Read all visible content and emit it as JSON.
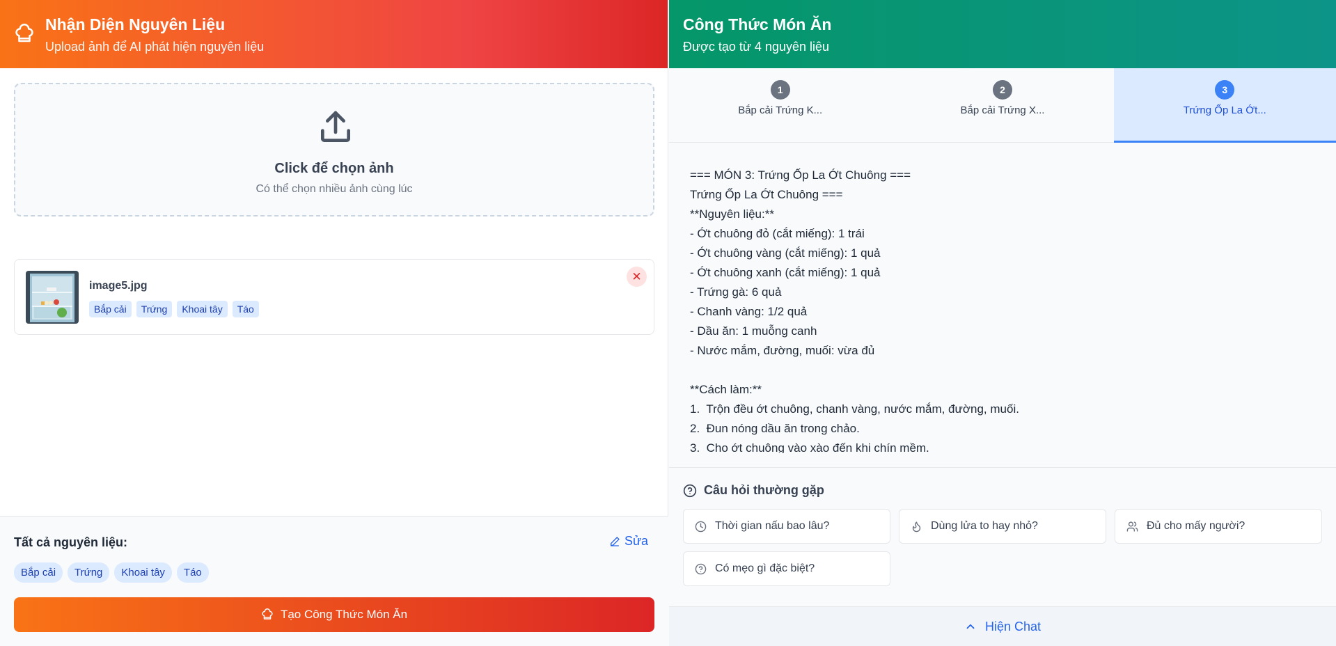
{
  "left_panel": {
    "header": {
      "title": "Nhận Diện Nguyên Liệu",
      "subtitle": "Upload ảnh để AI phát hiện nguyên liệu"
    },
    "upload": {
      "title": "Click để chọn ảnh",
      "hint": "Có thể chọn nhiều ảnh cùng lúc"
    },
    "files": [
      {
        "name": "image5.jpg",
        "tags": [
          "Bắp cải",
          "Trứng",
          "Khoai tây",
          "Táo"
        ],
        "remove_label": "✕"
      }
    ],
    "footer": {
      "all_label": "Tất cả nguyên liệu:",
      "edit_label": "Sửa",
      "ingredients": [
        "Bắp cải",
        "Trứng",
        "Khoai tây",
        "Táo"
      ],
      "generate_label": "Tạo Công Thức Món Ăn"
    }
  },
  "right_panel": {
    "header": {
      "title": "Công Thức Món Ăn",
      "subtitle": "Được tạo từ 4 nguyên liệu"
    },
    "tabs": [
      {
        "number": "1",
        "label": "Bắp cải Trứng K..."
      },
      {
        "number": "2",
        "label": "Bắp cải Trứng X..."
      },
      {
        "number": "3",
        "label": "Trứng Ốp La Ớt..."
      }
    ],
    "active_tab": 2,
    "recipe_lines": [
      "=== MÓN 3: Trứng Ốp La Ớt Chuông ===",
      "Trứng Ốp La Ớt Chuông ===",
      "**Nguyên liệu:**",
      "- Ớt chuông đỏ (cắt miếng): 1 trái",
      "- Ớt chuông vàng (cắt miếng): 1 quả",
      "- Ớt chuông xanh (cắt miếng): 1 quả",
      "- Trứng gà: 6 quả",
      "- Chanh vàng: 1/2 quả",
      "- Dầu ăn: 1 muỗng canh",
      "- Nước mắm, đường, muối: vừa đủ",
      "",
      "**Cách làm:**",
      "1.  Trộn đều ớt chuông, chanh vàng, nước mắm, đường, muối.",
      "2.  Đun nóng dầu ăn trong chảo.",
      "3.  Cho ớt chuông vào xào đến khi chín mềm."
    ],
    "faq": {
      "title": "Câu hỏi thường gặp",
      "questions": [
        {
          "label": "Thời gian nấu bao lâu?",
          "icon": "clock-icon"
        },
        {
          "label": "Dùng lửa to hay nhỏ?",
          "icon": "flame-icon"
        },
        {
          "label": "Đủ cho mấy người?",
          "icon": "users-icon"
        },
        {
          "label": "Có mẹo gì đặc biệt?",
          "icon": "help-circle-icon"
        }
      ]
    },
    "chat_toggle_label": "Hiện Chat"
  },
  "colors": {
    "left_header_start": "#f97316",
    "left_header_end": "#dc2626",
    "right_header_start": "#059669",
    "right_header_end": "#0d9488",
    "accent_blue": "#3b82f6",
    "tag_bg": "#dbeafe",
    "tag_text": "#1e40af"
  }
}
